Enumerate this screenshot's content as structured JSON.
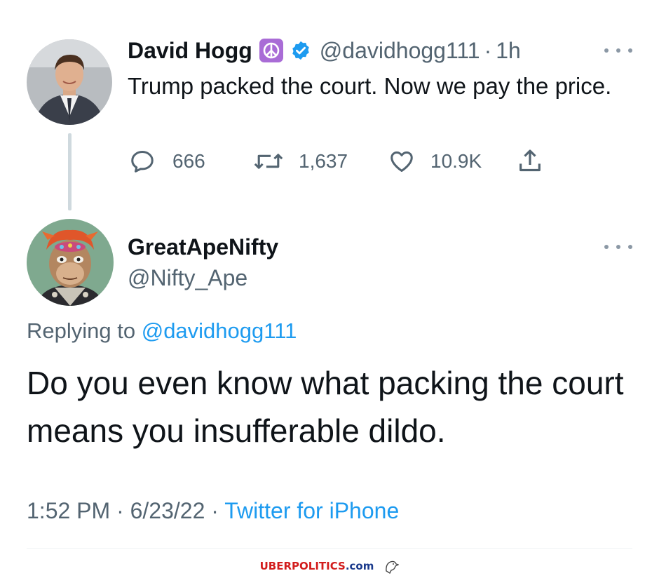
{
  "tweet1": {
    "name": "David Hogg",
    "peace_emoji": "☮",
    "handle": "@davidhogg111",
    "separator": "·",
    "time_ago": "1h",
    "text": "Trump packed the court. Now we pay the price.",
    "replies": "666",
    "retweets": "1,637",
    "likes": "10.9K"
  },
  "tweet2": {
    "name": "GreatApeNifty",
    "handle": "@Nifty_Ape",
    "replying_prefix": "Replying to",
    "replying_handle": "@davidhogg111",
    "text": "Do you even know what packing the court means you insufferable dildo.",
    "time": "1:52 PM",
    "date": "6/23/22",
    "source": "Twitter for iPhone",
    "separator": "·"
  },
  "watermark": {
    "part1": "UBER",
    "part2": "POLITICS",
    "part3": ".com"
  },
  "colors": {
    "link_blue": "#1d9bf0",
    "muted_gray": "#536471",
    "verified_blue": "#1d9bf0",
    "peace_purple": "#a96cd6"
  },
  "icons": [
    "reply-icon",
    "retweet-icon",
    "like-icon",
    "share-icon",
    "verified-badge-icon",
    "more-options-icon",
    "eagle-logo-icon"
  ]
}
